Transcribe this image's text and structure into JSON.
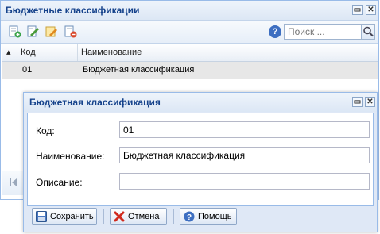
{
  "back_window": {
    "title": "Бюджетные классификации",
    "search_placeholder": "Поиск ...",
    "columns": [
      "Код",
      "Наименование"
    ],
    "rows": [
      {
        "code": "01",
        "name": "Бюджетная классификация"
      }
    ]
  },
  "dialog": {
    "title": "Бюджетная классификация",
    "fields": {
      "code_label": "Код:",
      "code_value": "01",
      "name_label": "Наименование:",
      "name_value": "Бюджетная классификация",
      "description_label": "Описание:",
      "description_value": ""
    },
    "buttons": {
      "save": "Сохранить",
      "cancel": "Отмена",
      "help": "Помощь"
    }
  },
  "colors": {
    "title_text": "#15428b",
    "border": "#99bbe8",
    "selected_row": "#e7e7e7"
  },
  "icons": {
    "add": "add-icon",
    "edit": "edit-icon",
    "edit_alt": "edit-list-icon",
    "delete": "delete-icon",
    "help": "help-icon",
    "search": "search-icon",
    "minimize": "minimize-icon",
    "close": "close-icon"
  }
}
